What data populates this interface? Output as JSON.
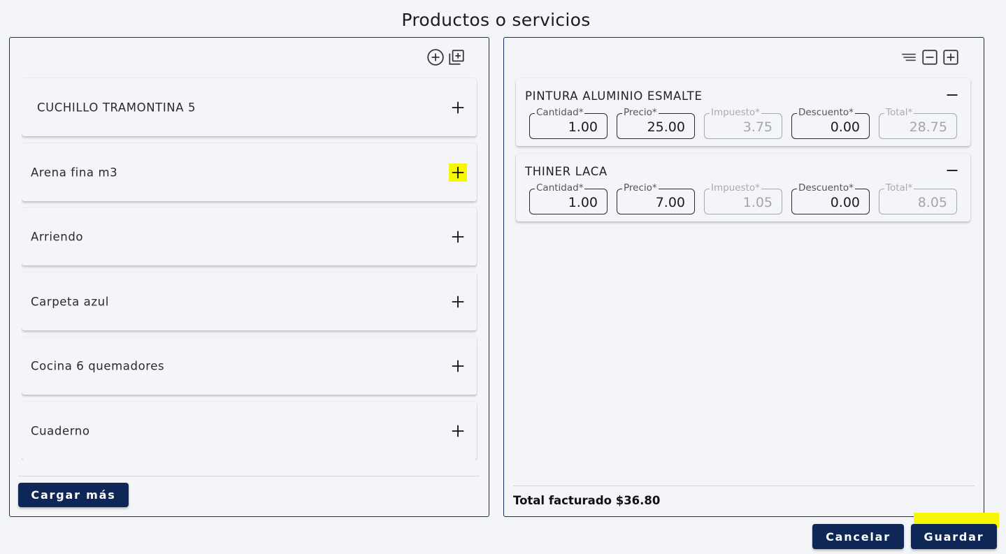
{
  "page": {
    "title": "Productos o servicios"
  },
  "left_panel": {
    "toolbar": {
      "add_icon": "circle-plus-icon",
      "add_multiple_icon": "library-add-icon"
    },
    "products": [
      {
        "name": "CUCHILLO TRAMONTINA 5",
        "action_icon": "plus-icon"
      },
      {
        "name": "Arena fina m3",
        "action_icon": "plus-icon",
        "highlighted": true
      },
      {
        "name": "Arriendo",
        "action_icon": "plus-icon"
      },
      {
        "name": "Carpeta azul",
        "action_icon": "plus-icon"
      },
      {
        "name": "Cocina 6 quemadores",
        "action_icon": "plus-icon"
      },
      {
        "name": "Cuaderno",
        "action_icon": "plus-icon"
      }
    ],
    "load_more_label": "Cargar más"
  },
  "right_panel": {
    "toolbar": {
      "sort_icon": "sort-lines-icon",
      "collapse_icon": "square-minus-icon",
      "expand_icon": "square-plus-icon"
    },
    "field_labels": {
      "quantity": "Cantidad*",
      "price": "Precio*",
      "tax": "Impuesto*",
      "discount": "Descuento*",
      "total": "Total*"
    },
    "items": [
      {
        "name": "PINTURA ALUMINIO ESMALTE",
        "quantity": "1.00",
        "price": "25.00",
        "tax": "3.75",
        "discount": "0.00",
        "total": "28.75"
      },
      {
        "name": "THINER LACA",
        "quantity": "1.00",
        "price": "7.00",
        "tax": "1.05",
        "discount": "0.00",
        "total": "8.05"
      }
    ],
    "total_text": "Total facturado $36.80"
  },
  "footer": {
    "cancel_label": "Cancelar",
    "save_label": "Guardar"
  },
  "colors": {
    "primary": "#0e2756",
    "border": "#16305e",
    "highlight": "#f6f700",
    "background": "#f4f5f8"
  }
}
